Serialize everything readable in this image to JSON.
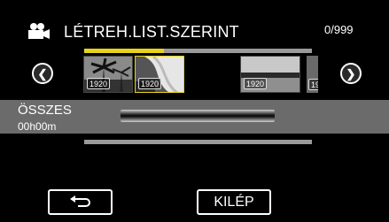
{
  "header": {
    "icon": "video-camera-icon",
    "title": "LÉTREH.LIST.SZERINT",
    "counter": "0/999"
  },
  "progress": {
    "fraction": 0.35
  },
  "thumbnails": [
    {
      "badge": "1920",
      "scene": "palm-trees-beach"
    },
    {
      "badge": "1920",
      "scene": "white-drape-shelf"
    },
    {
      "badge": "1920",
      "scene": "lake-horizon"
    },
    {
      "badge": "19",
      "scene": "partial"
    }
  ],
  "nav": {
    "prev_icon": "chevron-left-icon",
    "next_icon": "chevron-right-icon"
  },
  "info": {
    "label": "ÖSSZES",
    "duration": "00h00m"
  },
  "buttons": {
    "back_icon": "return-arrow-icon",
    "exit_label": "KILÉP"
  },
  "colors": {
    "accent": "#e8d21a",
    "band": "#6b6b6b",
    "track": "#9a9a9a"
  }
}
